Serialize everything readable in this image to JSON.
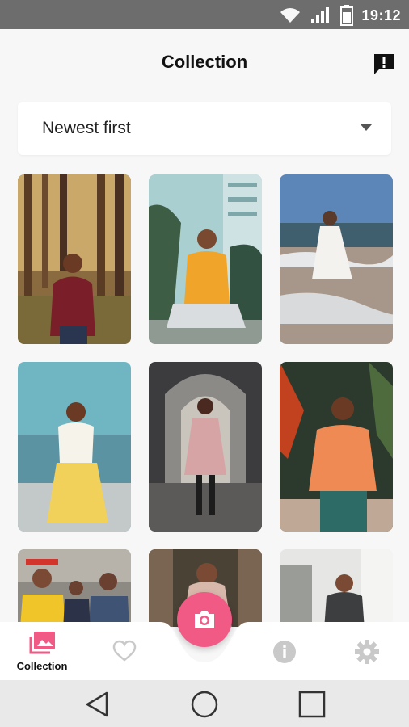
{
  "status_bar": {
    "time": "19:12",
    "icons": [
      "wifi-icon",
      "signal-icon",
      "battery-icon"
    ]
  },
  "header": {
    "title": "Collection",
    "action_icon": "report-icon"
  },
  "sort": {
    "selected": "Newest first"
  },
  "photos": [
    {
      "name": "photo-forest-woman"
    },
    {
      "name": "photo-yellow-sweater-woman"
    },
    {
      "name": "photo-beach-white-dress"
    },
    {
      "name": "photo-yellow-skirt-sea"
    },
    {
      "name": "photo-arcade-pink-coat"
    },
    {
      "name": "photo-orange-shirt-plants"
    },
    {
      "name": "photo-men-yellow-suit"
    },
    {
      "name": "photo-woman-scarf-street"
    },
    {
      "name": "photo-woman-gray-cardigan"
    }
  ],
  "bottom_nav": {
    "collection_label": "Collection",
    "items": [
      "collection-icon",
      "heart-icon",
      "camera-icon",
      "info-icon",
      "gear-icon"
    ]
  },
  "colors": {
    "accent": "#f05a85",
    "statusbar": "#6d6d6d",
    "background": "#f7f7f7"
  }
}
